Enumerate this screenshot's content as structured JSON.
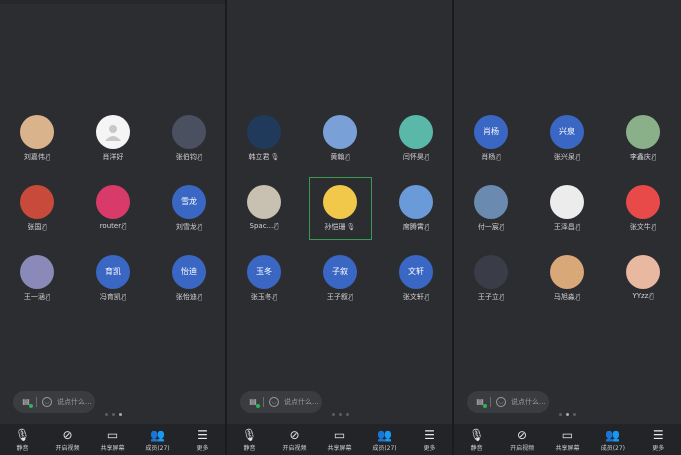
{
  "screens": [
    {
      "participants": [
        {
          "name": "刘嘉伟",
          "avatar": "photo",
          "color": "#d9b38c",
          "status": "muted"
        },
        {
          "name": "肖洋好",
          "avatar": "default",
          "color": "#f5f5f5",
          "status": "none"
        },
        {
          "name": "张伯钧",
          "avatar": "photo",
          "color": "#4a5060",
          "status": "muted"
        },
        {
          "name": "张国",
          "avatar": "photo",
          "color": "#c84a3a",
          "status": "muted"
        },
        {
          "name": "router",
          "avatar": "photo",
          "color": "#d83a6a",
          "status": "muted"
        },
        {
          "name": "刘雪龙",
          "avatar": "text",
          "initials": "雪龙",
          "color": "#3b67c4",
          "status": "muted"
        },
        {
          "name": "王一涵",
          "avatar": "photo",
          "color": "#8a8ab8",
          "status": "muted"
        },
        {
          "name": "冯育凯",
          "avatar": "text",
          "initials": "育凯",
          "color": "#3b67c4",
          "status": "muted"
        },
        {
          "name": "张怡迪",
          "avatar": "text",
          "initials": "怡迪",
          "color": "#3b67c4",
          "status": "muted"
        }
      ],
      "chat_placeholder": "说点什么...",
      "page_dots": [
        false,
        false,
        true
      ]
    },
    {
      "participants": [
        {
          "name": "韩立君",
          "avatar": "photo",
          "color": "#1f3a5a",
          "status": "mic"
        },
        {
          "name": "黄翰",
          "avatar": "photo",
          "color": "#7aa0d8",
          "status": "muted"
        },
        {
          "name": "闫怀昊",
          "avatar": "photo",
          "color": "#5ab8a8",
          "status": "muted"
        },
        {
          "name": "Spac...",
          "avatar": "photo",
          "color": "#c8c0b0",
          "status": "muted"
        },
        {
          "name": "孙恺珊",
          "avatar": "photo",
          "color": "#f2c84a",
          "status": "mic"
        },
        {
          "name": "席腾霄",
          "avatar": "photo",
          "color": "#6a9ad8",
          "status": "muted"
        },
        {
          "name": "张玉冬",
          "avatar": "text",
          "initials": "玉冬",
          "color": "#3b67c4",
          "status": "muted"
        },
        {
          "name": "王子叙",
          "avatar": "text",
          "initials": "子叙",
          "color": "#3b67c4",
          "status": "muted"
        },
        {
          "name": "张文轩",
          "avatar": "text",
          "initials": "文轩",
          "color": "#3b67c4",
          "status": "muted"
        }
      ],
      "chat_placeholder": "说点什么...",
      "page_dots": [
        false,
        false,
        false
      ]
    },
    {
      "participants": [
        {
          "name": "肖杨",
          "avatar": "text",
          "initials": "肖杨",
          "color": "#3b67c4",
          "status": "muted"
        },
        {
          "name": "张兴泉",
          "avatar": "text",
          "initials": "兴泉",
          "color": "#3b67c4",
          "status": "muted"
        },
        {
          "name": "李鑫庆",
          "avatar": "photo",
          "color": "#8ab08a",
          "status": "muted"
        },
        {
          "name": "付一宸",
          "avatar": "photo",
          "color": "#6a8ab0",
          "status": "muted"
        },
        {
          "name": "王泽昌",
          "avatar": "photo",
          "color": "#ececec",
          "status": "muted"
        },
        {
          "name": "张文牛",
          "avatar": "photo",
          "color": "#e84a4a",
          "status": "muted"
        },
        {
          "name": "王子立",
          "avatar": "photo",
          "color": "#3a3c48",
          "status": "muted"
        },
        {
          "name": "马旭淼",
          "avatar": "photo",
          "color": "#d8a878",
          "status": "muted"
        },
        {
          "name": "YYzz",
          "avatar": "photo",
          "color": "#e8b8a0",
          "status": "muted"
        }
      ],
      "chat_placeholder": "说点什么...",
      "page_dots": [
        false,
        true,
        false
      ]
    }
  ],
  "toolbars": [
    [
      "静音",
      "开启视频",
      "共享屏幕",
      "成员(27)",
      "更多"
    ],
    [
      "静音",
      "开启视频",
      "共享屏幕",
      "成员(27)",
      "更多"
    ],
    [
      "静音",
      "开启视频",
      "共享屏幕",
      "成员(27)",
      "更多"
    ]
  ],
  "toolbar_icons": [
    "mic-icon",
    "video-off-icon",
    "share-screen-icon",
    "members-icon",
    "more-icon"
  ],
  "colors": {
    "background": "#2c2d31",
    "avatar_blue": "#3b67c4",
    "speaking_border": "#3a9a55"
  }
}
